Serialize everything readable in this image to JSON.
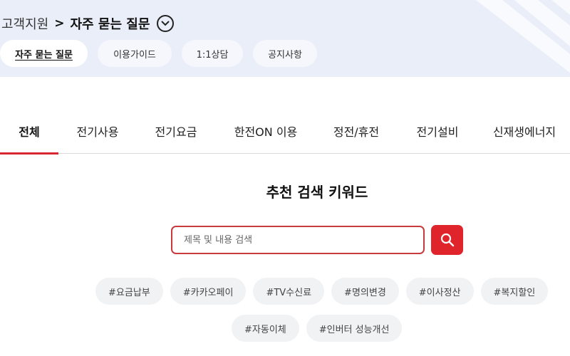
{
  "breadcrumb": {
    "root": "고객지원",
    "separator": ">",
    "current": "자주 묻는 질문"
  },
  "subnav": [
    {
      "label": "자주 묻는 질문",
      "active": true
    },
    {
      "label": "이용가이드",
      "active": false
    },
    {
      "label": "1:1상담",
      "active": false
    },
    {
      "label": "공지사항",
      "active": false
    }
  ],
  "tabs": [
    {
      "label": "전체",
      "active": true
    },
    {
      "label": "전기사용",
      "active": false
    },
    {
      "label": "전기요금",
      "active": false
    },
    {
      "label": "한전ON 이용",
      "active": false
    },
    {
      "label": "정전/휴전",
      "active": false
    },
    {
      "label": "전기설비",
      "active": false
    },
    {
      "label": "신재생에너지",
      "active": false
    }
  ],
  "search": {
    "title": "추천 검색 키워드",
    "placeholder": "제목 및 내용 검색",
    "value": "",
    "button_icon": "search-icon"
  },
  "keywords": [
    "#요금납부",
    "#카카오페이",
    "#TV수신료",
    "#명의변경",
    "#이사정산",
    "#복지할인",
    "#자동이체",
    "#인버터 성능개선"
  ],
  "colors": {
    "accent": "#e0242c",
    "band": "#e9eef8",
    "chip": "#f1f2f4"
  }
}
